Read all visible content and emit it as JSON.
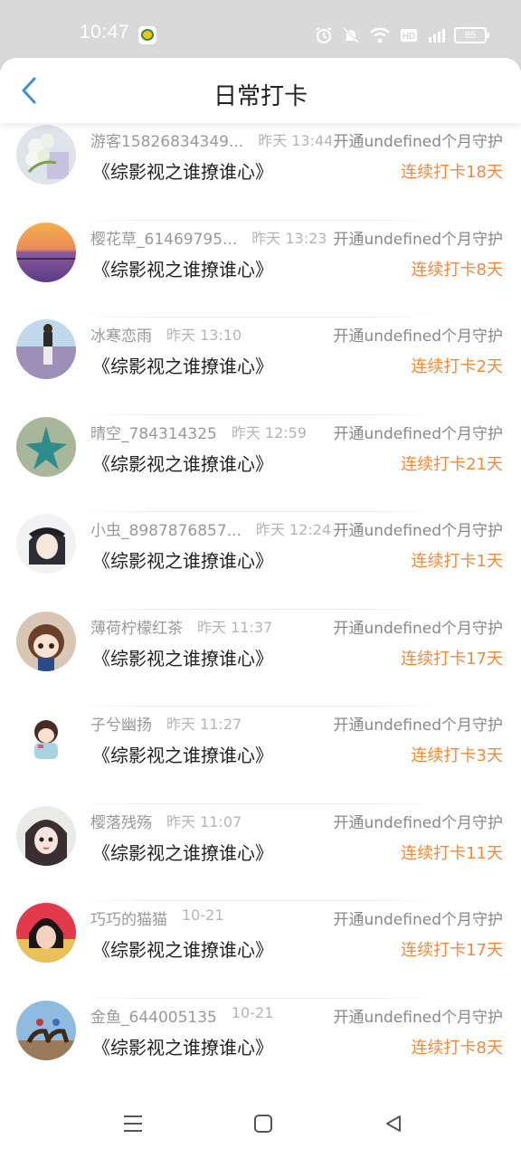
{
  "status_bar": {
    "time": "10:47",
    "battery": "85",
    "icons": [
      "app-notification-icon",
      "alarm-icon",
      "mute-icon",
      "wifi-icon",
      "hd-icon",
      "signal-4g-icon",
      "battery-icon"
    ]
  },
  "header": {
    "title": "日常打卡",
    "back_icon": "chevron-left-icon",
    "accent_color": "#3b8ee0"
  },
  "colors": {
    "streak": "#f08a3a",
    "muted_text": "#999999",
    "primary_text": "#222222"
  },
  "list": {
    "items": [
      {
        "name": "游客15826834349...",
        "time": "昨天 13:44",
        "guard": "开通undefined个月守护",
        "book": "《综影视之谁撩谁心》",
        "streak": "连续打卡18天",
        "avatar": "lily"
      },
      {
        "name": "樱花草_61469795...",
        "time": "昨天 13:23",
        "guard": "开通undefined个月守护",
        "book": "《综影视之谁撩谁心》",
        "streak": "连续打卡8天",
        "avatar": "lavender"
      },
      {
        "name": "冰寒恋雨",
        "time": "昨天 13:10",
        "guard": "开通undefined个月守护",
        "book": "《综影视之谁撩谁心》",
        "streak": "连续打卡2天",
        "avatar": "field"
      },
      {
        "name": "晴空_784314325",
        "time": "昨天 12:59",
        "guard": "开通undefined个月守护",
        "book": "《综影视之谁撩谁心》",
        "streak": "连续打卡21天",
        "avatar": "starfish"
      },
      {
        "name": "小虫_8987876857...",
        "time": "昨天 12:24",
        "guard": "开通undefined个月守护",
        "book": "《综影视之谁撩谁心》",
        "streak": "连续打卡1天",
        "avatar": "girl-cap"
      },
      {
        "name": "薄荷柠檬红茶",
        "time": "昨天 11:37",
        "guard": "开通undefined个月守护",
        "book": "《综影视之谁撩谁心》",
        "streak": "连续打卡17天",
        "avatar": "anime-girl"
      },
      {
        "name": "子兮幽扬",
        "time": "昨天 11:27",
        "guard": "开通undefined个月守护",
        "book": "《综影视之谁撩谁心》",
        "streak": "连续打卡3天",
        "avatar": "chibi"
      },
      {
        "name": "樱落残殇",
        "time": "昨天 11:07",
        "guard": "开通undefined个月守护",
        "book": "《综影视之谁撩谁心》",
        "streak": "连续打卡11天",
        "avatar": "ancient-girl"
      },
      {
        "name": "巧巧的猫猫",
        "time": "10-21",
        "guard": "开通undefined个月守护",
        "book": "《综影视之谁撩谁心》",
        "streak": "连续打卡17天",
        "avatar": "woman-red"
      },
      {
        "name": "金鱼_644005135",
        "time": "10-21",
        "guard": "开通undefined个月守护",
        "book": "《综影视之谁撩谁心》",
        "streak": "连续打卡8天",
        "avatar": "horses"
      }
    ]
  },
  "nav_bar": {
    "icons": [
      "menu-icon",
      "home-square-icon",
      "back-triangle-icon"
    ]
  }
}
